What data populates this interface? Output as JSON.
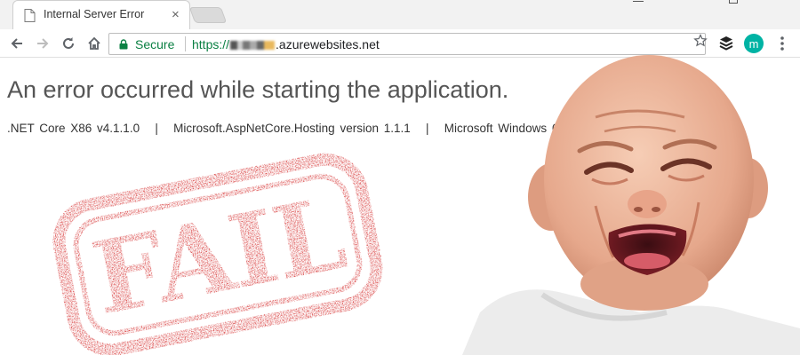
{
  "browser": {
    "tab_title": "Internal Server Error",
    "tab_close": "×",
    "secure_label": "Secure",
    "url_scheme": "https://",
    "url_host": ".azurewebsites.net",
    "extension_avatar_letter": "m",
    "colors": {
      "secure_green": "#0b8043",
      "extension_teal": "#00b3a4"
    }
  },
  "page": {
    "heading": "An error occurred while starting the application.",
    "runtime_info": ".NET Core X86 v4.1.1.0",
    "hosting_info": "Microsoft.AspNetCore.Hosting version 1.1.1",
    "os_info": "Microsoft Windows 6.2.9",
    "separator": "|"
  },
  "overlay": {
    "stamp_text": "FAIL",
    "stamp_color": "#d11a1a"
  }
}
